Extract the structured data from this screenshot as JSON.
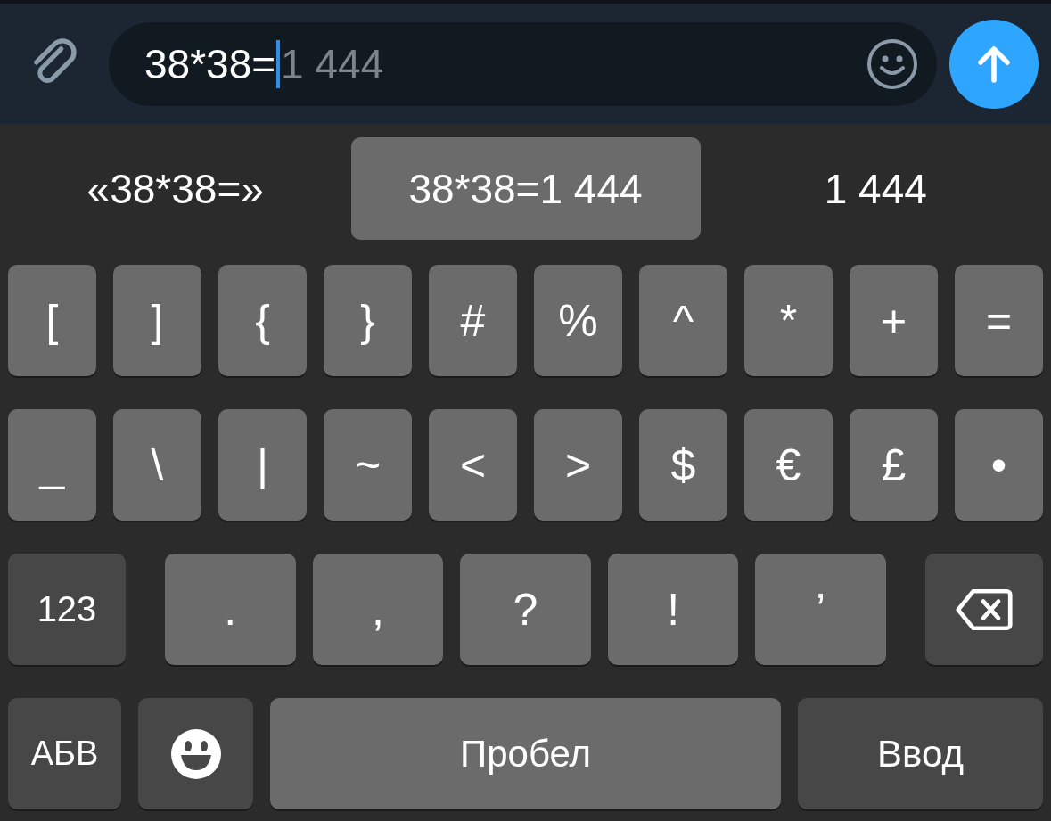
{
  "composer": {
    "value": "38*38=",
    "completion": "1 444"
  },
  "suggestions": [
    {
      "text": "«38*38=»",
      "selected": false
    },
    {
      "text": "38*38=1 444",
      "selected": true
    },
    {
      "text": "1 444",
      "selected": false
    }
  ],
  "rows": [
    {
      "keys": [
        {
          "kind": "char",
          "label": "["
        },
        {
          "kind": "char",
          "label": "]"
        },
        {
          "kind": "char",
          "label": "{"
        },
        {
          "kind": "char",
          "label": "}"
        },
        {
          "kind": "char",
          "label": "#"
        },
        {
          "kind": "char",
          "label": "%"
        },
        {
          "kind": "char",
          "label": "^"
        },
        {
          "kind": "char",
          "label": "*"
        },
        {
          "kind": "char",
          "label": "+"
        },
        {
          "kind": "char",
          "label": "="
        }
      ]
    },
    {
      "keys": [
        {
          "kind": "char",
          "label": "_"
        },
        {
          "kind": "char",
          "label": "\\"
        },
        {
          "kind": "char",
          "label": "|"
        },
        {
          "kind": "char",
          "label": "~"
        },
        {
          "kind": "char",
          "label": "<"
        },
        {
          "kind": "char",
          "label": ">"
        },
        {
          "kind": "char",
          "label": "$"
        },
        {
          "kind": "char",
          "label": "€"
        },
        {
          "kind": "char",
          "label": "£"
        },
        {
          "kind": "char",
          "label": "•"
        }
      ]
    },
    {
      "keys": [
        {
          "kind": "function",
          "label": "123"
        },
        {
          "kind": "char",
          "label": "."
        },
        {
          "kind": "char",
          "label": ","
        },
        {
          "kind": "char",
          "label": "?"
        },
        {
          "kind": "char",
          "label": "!"
        },
        {
          "kind": "char",
          "label": "’"
        },
        {
          "kind": "backspace"
        }
      ]
    },
    {
      "keys": [
        {
          "kind": "function",
          "label": "АБВ"
        },
        {
          "kind": "emoji"
        },
        {
          "kind": "space",
          "label": "Пробел"
        },
        {
          "kind": "enter",
          "label": "Ввод"
        }
      ]
    }
  ]
}
